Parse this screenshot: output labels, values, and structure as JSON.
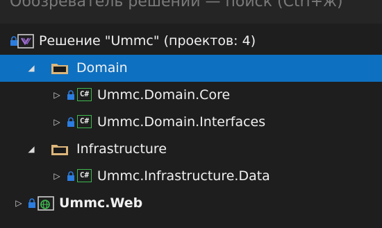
{
  "panel": {
    "title": "Обозреватель решений — поиск (Ctrl+ж)"
  },
  "tree": {
    "solution": {
      "label": "Решение \"Ummc\"  (проектов: 4)"
    },
    "domain": {
      "label": "Domain"
    },
    "core": {
      "label": "Ummc.Domain.Core",
      "lang": "C#"
    },
    "interfaces": {
      "label": "Ummc.Domain.Interfaces",
      "lang": "C#"
    },
    "infrastructure": {
      "label": "Infrastructure"
    },
    "data": {
      "label": "Ummc.Infrastructure.Data",
      "lang": "C#"
    },
    "web": {
      "label": "Ummc.Web"
    }
  },
  "colors": {
    "background": "#1e1e1e",
    "selection": "#0e70c0",
    "folder": "#dcb67a",
    "csharp": "#3fb950",
    "lock": "#2b7de0",
    "web": "#3fb950"
  }
}
